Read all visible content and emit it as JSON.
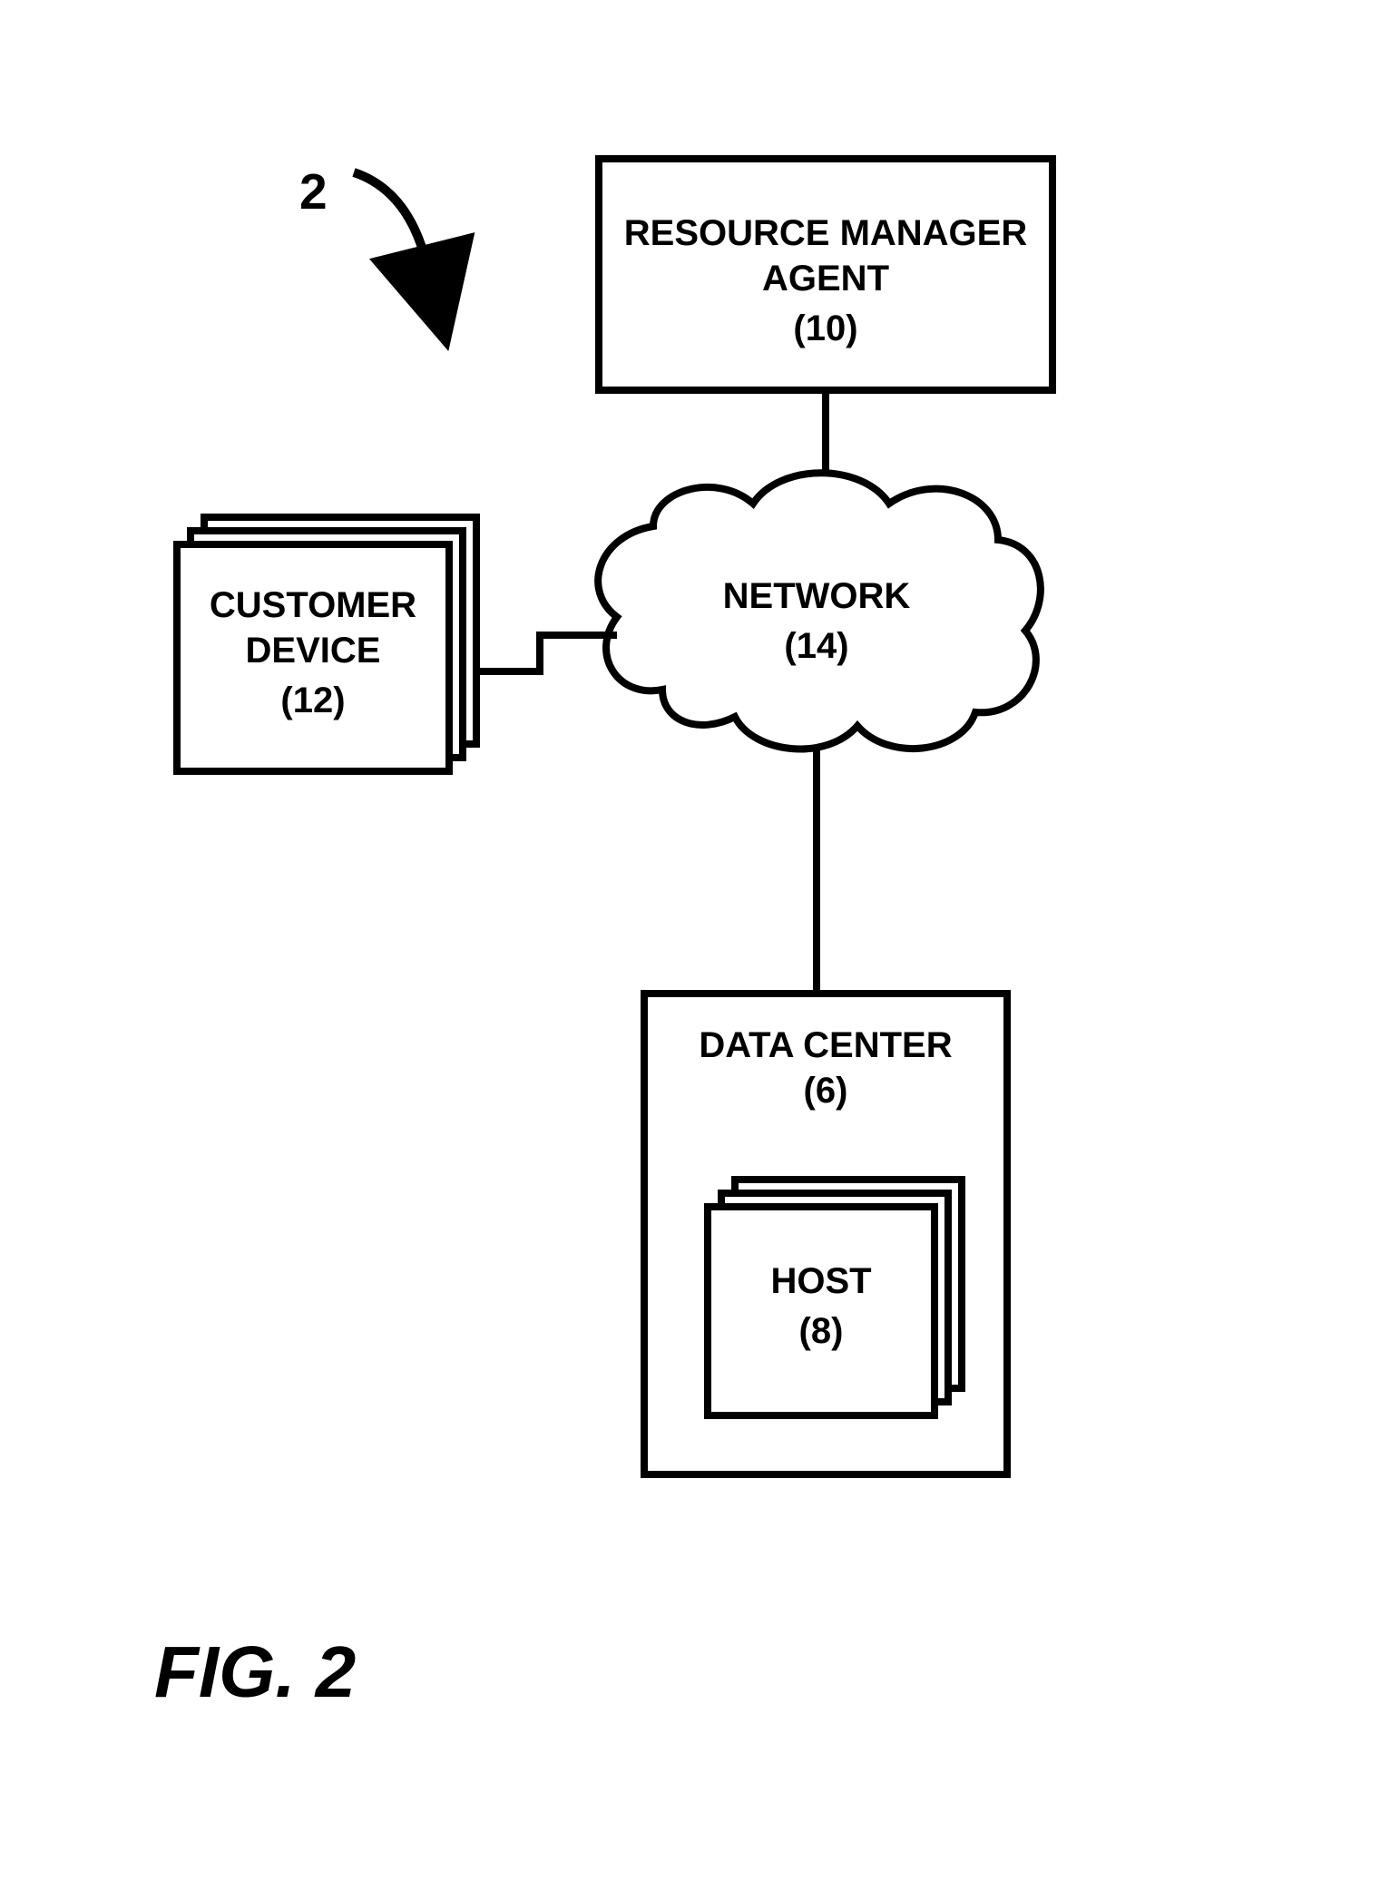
{
  "figure": {
    "label": "FIG. 2",
    "reference_numeral": "2"
  },
  "nodes": {
    "resource_manager_agent": {
      "title": "RESOURCE MANAGER",
      "subtitle": "AGENT",
      "ref": "(10)"
    },
    "customer_device": {
      "title": "CUSTOMER",
      "subtitle": "DEVICE",
      "ref": "(12)"
    },
    "network": {
      "title": "NETWORK",
      "ref": "(14)"
    },
    "data_center": {
      "title": "DATA CENTER",
      "ref": "(6)"
    },
    "host": {
      "title": "HOST",
      "ref": "(8)"
    }
  }
}
